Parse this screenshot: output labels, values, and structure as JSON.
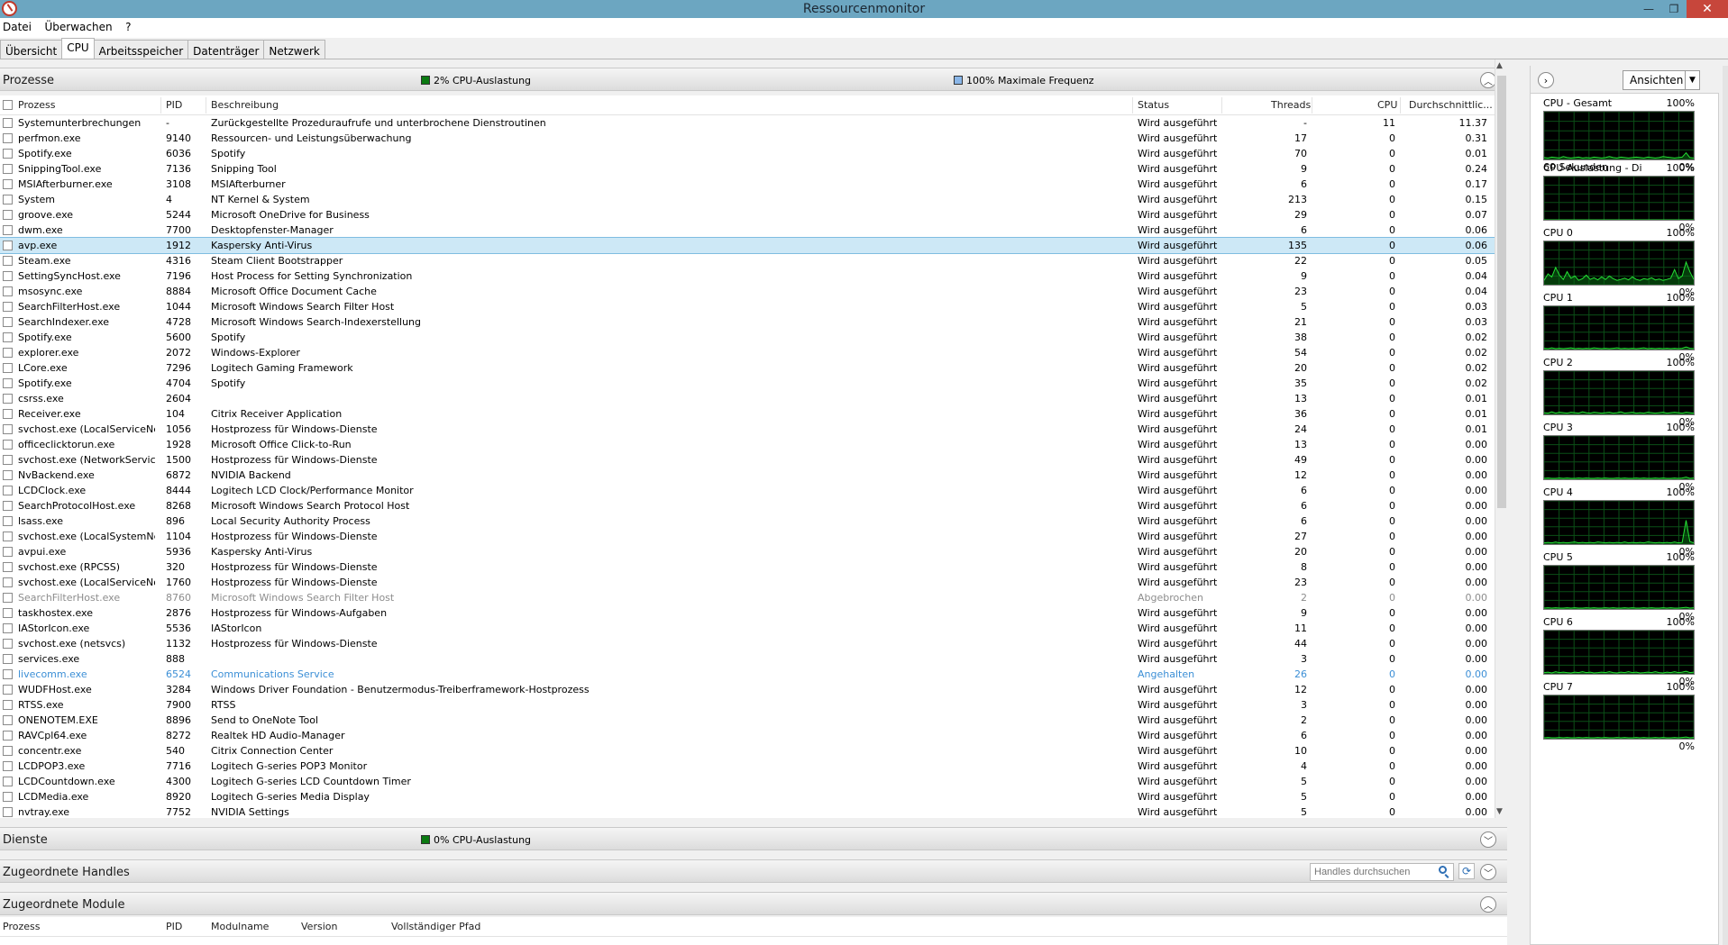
{
  "window": {
    "title": "Ressourcenmonitor"
  },
  "menu": [
    "Datei",
    "Überwachen",
    "?"
  ],
  "tabs": [
    "Übersicht",
    "CPU",
    "Arbeitsspeicher",
    "Datenträger",
    "Netzwerk"
  ],
  "active_tab": "CPU",
  "processes": {
    "title": "Prozesse",
    "legend1": "2% CPU-Auslastung",
    "legend1_color": "#0b7a12",
    "legend2": "100% Maximale Frequenz",
    "legend2_color": "#8ab6e8",
    "columns": [
      "Prozess",
      "PID",
      "Beschreibung",
      "Status",
      "Threads",
      "CPU",
      "Durchschnittlic..."
    ],
    "rows": [
      [
        "Systemunterbrechungen",
        "-",
        "Zurückgestellte Prozeduraufrufe und unterbrochene Dienstroutinen",
        "Wird ausgeführt",
        "-",
        "11",
        "11.37"
      ],
      [
        "perfmon.exe",
        "9140",
        "Ressourcen- und Leistungsüberwachung",
        "Wird ausgeführt",
        "17",
        "0",
        "0.31"
      ],
      [
        "Spotify.exe",
        "6036",
        "Spotify",
        "Wird ausgeführt",
        "70",
        "0",
        "0.01"
      ],
      [
        "SnippingTool.exe",
        "7136",
        "Snipping Tool",
        "Wird ausgeführt",
        "9",
        "0",
        "0.24"
      ],
      [
        "MSIAfterburner.exe",
        "3108",
        "MSIAfterburner",
        "Wird ausgeführt",
        "6",
        "0",
        "0.17"
      ],
      [
        "System",
        "4",
        "NT Kernel & System",
        "Wird ausgeführt",
        "213",
        "0",
        "0.15"
      ],
      [
        "groove.exe",
        "5244",
        "Microsoft OneDrive for Business",
        "Wird ausgeführt",
        "29",
        "0",
        "0.07"
      ],
      [
        "dwm.exe",
        "7700",
        "Desktopfenster-Manager",
        "Wird ausgeführt",
        "6",
        "0",
        "0.06"
      ],
      [
        "avp.exe",
        "1912",
        "Kaspersky Anti-Virus",
        "Wird ausgeführt",
        "135",
        "0",
        "0.06"
      ],
      [
        "Steam.exe",
        "4316",
        "Steam Client Bootstrapper",
        "Wird ausgeführt",
        "22",
        "0",
        "0.05"
      ],
      [
        "SettingSyncHost.exe",
        "7196",
        "Host Process for Setting Synchronization",
        "Wird ausgeführt",
        "9",
        "0",
        "0.04"
      ],
      [
        "msosync.exe",
        "8884",
        "Microsoft Office Document Cache",
        "Wird ausgeführt",
        "23",
        "0",
        "0.04"
      ],
      [
        "SearchFilterHost.exe",
        "1044",
        "Microsoft Windows Search Filter Host",
        "Wird ausgeführt",
        "5",
        "0",
        "0.03"
      ],
      [
        "SearchIndexer.exe",
        "4728",
        "Microsoft Windows Search-Indexerstellung",
        "Wird ausgeführt",
        "21",
        "0",
        "0.03"
      ],
      [
        "Spotify.exe",
        "5600",
        "Spotify",
        "Wird ausgeführt",
        "38",
        "0",
        "0.02"
      ],
      [
        "explorer.exe",
        "2072",
        "Windows-Explorer",
        "Wird ausgeführt",
        "54",
        "0",
        "0.02"
      ],
      [
        "LCore.exe",
        "7296",
        "Logitech Gaming Framework",
        "Wird ausgeführt",
        "20",
        "0",
        "0.02"
      ],
      [
        "Spotify.exe",
        "4704",
        "Spotify",
        "Wird ausgeführt",
        "35",
        "0",
        "0.02"
      ],
      [
        "csrss.exe",
        "2604",
        "",
        "Wird ausgeführt",
        "13",
        "0",
        "0.01"
      ],
      [
        "Receiver.exe",
        "104",
        "Citrix Receiver Application",
        "Wird ausgeführt",
        "36",
        "0",
        "0.01"
      ],
      [
        "svchost.exe (LocalServiceNet...",
        "1056",
        "Hostprozess für Windows-Dienste",
        "Wird ausgeführt",
        "24",
        "0",
        "0.01"
      ],
      [
        "officeclicktorun.exe",
        "1928",
        "Microsoft Office Click-to-Run",
        "Wird ausgeführt",
        "13",
        "0",
        "0.00"
      ],
      [
        "svchost.exe (NetworkService)",
        "1500",
        "Hostprozess für Windows-Dienste",
        "Wird ausgeführt",
        "49",
        "0",
        "0.00"
      ],
      [
        "NvBackend.exe",
        "6872",
        "NVIDIA Backend",
        "Wird ausgeführt",
        "12",
        "0",
        "0.00"
      ],
      [
        "LCDClock.exe",
        "8444",
        "Logitech LCD Clock/Performance Monitor",
        "Wird ausgeführt",
        "6",
        "0",
        "0.00"
      ],
      [
        "SearchProtocolHost.exe",
        "8268",
        "Microsoft Windows Search Protocol Host",
        "Wird ausgeführt",
        "6",
        "0",
        "0.00"
      ],
      [
        "lsass.exe",
        "896",
        "Local Security Authority Process",
        "Wird ausgeführt",
        "6",
        "0",
        "0.00"
      ],
      [
        "svchost.exe (LocalSystemNet...",
        "1104",
        "Hostprozess für Windows-Dienste",
        "Wird ausgeführt",
        "27",
        "0",
        "0.00"
      ],
      [
        "avpui.exe",
        "5936",
        "Kaspersky Anti-Virus",
        "Wird ausgeführt",
        "20",
        "0",
        "0.00"
      ],
      [
        "svchost.exe (RPCSS)",
        "320",
        "Hostprozess für Windows-Dienste",
        "Wird ausgeführt",
        "8",
        "0",
        "0.00"
      ],
      [
        "svchost.exe (LocalServiceNo...",
        "1760",
        "Hostprozess für Windows-Dienste",
        "Wird ausgeführt",
        "23",
        "0",
        "0.00"
      ],
      [
        "SearchFilterHost.exe",
        "8760",
        "Microsoft Windows Search Filter Host",
        "Abgebrochen",
        "2",
        "0",
        "0.00"
      ],
      [
        "taskhostex.exe",
        "2876",
        "Hostprozess für Windows-Aufgaben",
        "Wird ausgeführt",
        "9",
        "0",
        "0.00"
      ],
      [
        "IAStorIcon.exe",
        "5536",
        "IAStorIcon",
        "Wird ausgeführt",
        "11",
        "0",
        "0.00"
      ],
      [
        "svchost.exe (netsvcs)",
        "1132",
        "Hostprozess für Windows-Dienste",
        "Wird ausgeführt",
        "44",
        "0",
        "0.00"
      ],
      [
        "services.exe",
        "888",
        "",
        "Wird ausgeführt",
        "3",
        "0",
        "0.00"
      ],
      [
        "livecomm.exe",
        "6524",
        "Communications Service",
        "Angehalten",
        "26",
        "0",
        "0.00"
      ],
      [
        "WUDFHost.exe",
        "3284",
        "Windows Driver Foundation - Benutzermodus-Treiberframework-Hostprozess",
        "Wird ausgeführt",
        "12",
        "0",
        "0.00"
      ],
      [
        "RTSS.exe",
        "7900",
        "RTSS",
        "Wird ausgeführt",
        "3",
        "0",
        "0.00"
      ],
      [
        "ONENOTEM.EXE",
        "8896",
        "Send to OneNote Tool",
        "Wird ausgeführt",
        "2",
        "0",
        "0.00"
      ],
      [
        "RAVCpl64.exe",
        "8272",
        "Realtek HD Audio-Manager",
        "Wird ausgeführt",
        "6",
        "0",
        "0.00"
      ],
      [
        "concentr.exe",
        "540",
        "Citrix Connection Center",
        "Wird ausgeführt",
        "10",
        "0",
        "0.00"
      ],
      [
        "LCDPOP3.exe",
        "7716",
        "Logitech G-series POP3 Monitor",
        "Wird ausgeführt",
        "4",
        "0",
        "0.00"
      ],
      [
        "LCDCountdown.exe",
        "4300",
        "Logitech G-series LCD Countdown Timer",
        "Wird ausgeführt",
        "5",
        "0",
        "0.00"
      ],
      [
        "LCDMedia.exe",
        "8920",
        "Logitech G-series Media Display",
        "Wird ausgeführt",
        "5",
        "0",
        "0.00"
      ],
      [
        "nvtray.exe",
        "7752",
        "NVIDIA Settings",
        "Wird ausgeführt",
        "5",
        "0",
        "0.00"
      ]
    ],
    "selected_row": "avp.exe",
    "status_colors": {
      "Abgebrochen": "#8c8c8c",
      "Angehalten": "#3c8fd6"
    }
  },
  "services": {
    "title": "Dienste",
    "legend": "0% CPU-Auslastung",
    "legend_color": "#0b7a12"
  },
  "handles": {
    "title": "Zugeordnete Handles",
    "search_placeholder": "Handles durchsuchen"
  },
  "modules": {
    "title": "Zugeordnete Module",
    "columns": [
      "Prozess",
      "PID",
      "Modulname",
      "Version",
      "Vollständiger Pfad"
    ]
  },
  "right_panel": {
    "views_label": "Ansichten",
    "graphs": [
      {
        "title": "CPU - Gesamt",
        "top": "100%",
        "bottom_left": "60 Sekunden",
        "bottom_right": "0%",
        "values": [
          4,
          3,
          5,
          4,
          3,
          6,
          4,
          3,
          4,
          5,
          3,
          4,
          3,
          5,
          4,
          3,
          4,
          6,
          4,
          3,
          5,
          4,
          3,
          4,
          5,
          4,
          3,
          5,
          4,
          3,
          4,
          6,
          5,
          4,
          3,
          4,
          5,
          14,
          4,
          3
        ]
      },
      {
        "title": "CPU-Auslastung - Dien...",
        "top": "100%",
        "bottom_left": "",
        "bottom_right": "0%",
        "values": [
          0,
          0,
          0,
          0,
          0,
          0,
          0,
          0,
          0,
          0,
          0,
          0,
          0,
          0,
          0,
          0,
          0,
          0,
          0,
          0,
          0,
          0,
          0,
          0,
          0,
          0,
          0,
          0,
          0,
          0,
          0,
          0,
          0,
          0,
          0,
          0,
          0,
          0,
          0,
          0
        ]
      },
      {
        "title": "CPU 0",
        "top": "100%",
        "bottom_left": "",
        "bottom_right": "0%",
        "values": [
          10,
          25,
          18,
          40,
          22,
          12,
          30,
          15,
          20,
          10,
          14,
          22,
          12,
          16,
          11,
          18,
          12,
          20,
          14,
          10,
          12,
          15,
          11,
          18,
          12,
          10,
          14,
          12,
          16,
          11,
          13,
          10,
          12,
          15,
          35,
          14,
          20,
          52,
          30,
          12
        ]
      },
      {
        "title": "CPU 1",
        "top": "100%",
        "bottom_left": "",
        "bottom_right": "0%",
        "values": [
          3,
          2,
          4,
          2,
          3,
          2,
          3,
          4,
          2,
          3,
          2,
          3,
          2,
          4,
          3,
          2,
          3,
          2,
          3,
          4,
          2,
          3,
          2,
          3,
          2,
          3,
          4,
          2,
          3,
          2,
          3,
          2,
          3,
          2,
          3,
          2,
          3,
          6,
          3,
          2
        ]
      },
      {
        "title": "CPU 2",
        "top": "100%",
        "bottom_left": "",
        "bottom_right": "0%",
        "values": [
          4,
          3,
          6,
          3,
          5,
          4,
          3,
          5,
          4,
          3,
          6,
          4,
          3,
          5,
          4,
          3,
          4,
          5,
          3,
          4,
          6,
          3,
          4,
          5,
          3,
          4,
          3,
          5,
          4,
          3,
          4,
          5,
          3,
          4,
          5,
          4,
          3,
          5,
          4,
          3
        ]
      },
      {
        "title": "CPU 3",
        "top": "100%",
        "bottom_left": "",
        "bottom_right": "0%",
        "values": [
          2,
          3,
          2,
          2,
          3,
          2,
          3,
          2,
          2,
          3,
          2,
          3,
          2,
          2,
          3,
          2,
          3,
          2,
          2,
          3,
          2,
          3,
          2,
          2,
          3,
          2,
          3,
          2,
          2,
          3,
          2,
          3,
          2,
          2,
          3,
          2,
          3,
          5,
          2,
          3
        ]
      },
      {
        "title": "CPU 4",
        "top": "100%",
        "bottom_left": "",
        "bottom_right": "0%",
        "values": [
          3,
          4,
          3,
          5,
          3,
          4,
          3,
          4,
          5,
          3,
          4,
          3,
          4,
          3,
          5,
          4,
          3,
          4,
          3,
          4,
          3,
          5,
          3,
          4,
          3,
          4,
          3,
          5,
          4,
          3,
          4,
          3,
          4,
          3,
          5,
          3,
          4,
          55,
          6,
          3
        ]
      },
      {
        "title": "CPU 5",
        "top": "100%",
        "bottom_left": "",
        "bottom_right": "0%",
        "values": [
          2,
          3,
          2,
          3,
          2,
          2,
          3,
          2,
          3,
          2,
          2,
          3,
          2,
          3,
          2,
          2,
          3,
          2,
          3,
          2,
          2,
          3,
          2,
          3,
          2,
          2,
          3,
          2,
          3,
          2,
          2,
          3,
          2,
          3,
          2,
          2,
          3,
          4,
          2,
          3
        ]
      },
      {
        "title": "CPU 6",
        "top": "100%",
        "bottom_left": "",
        "bottom_right": "0%",
        "values": [
          3,
          4,
          2,
          5,
          3,
          4,
          3,
          2,
          4,
          3,
          5,
          3,
          4,
          2,
          3,
          4,
          3,
          5,
          3,
          2,
          4,
          3,
          5,
          3,
          4,
          2,
          3,
          4,
          3,
          5,
          3,
          2,
          4,
          3,
          5,
          3,
          4,
          6,
          3,
          4
        ]
      },
      {
        "title": "CPU 7",
        "top": "100%",
        "bottom_left": "",
        "bottom_right": "0%",
        "values": [
          2,
          3,
          2,
          2,
          3,
          2,
          3,
          2,
          2,
          3,
          2,
          3,
          2,
          2,
          3,
          2,
          3,
          2,
          2,
          3,
          2,
          3,
          2,
          2,
          3,
          2,
          3,
          2,
          2,
          3,
          2,
          3,
          2,
          2,
          3,
          2,
          3,
          4,
          2,
          3
        ]
      }
    ]
  }
}
